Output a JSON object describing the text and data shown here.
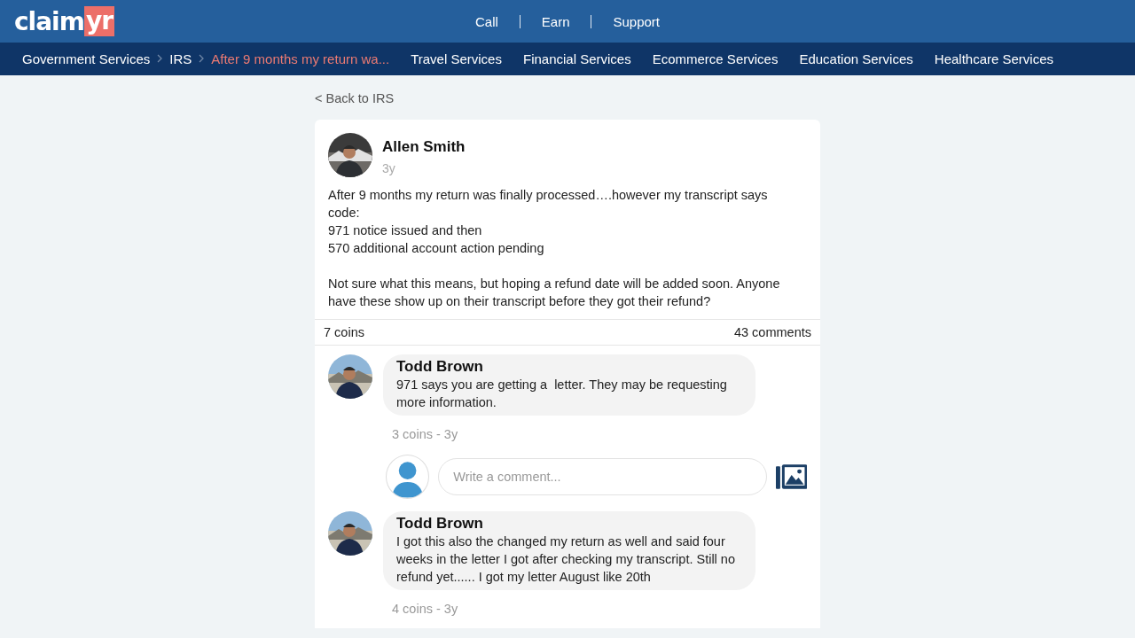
{
  "header": {
    "logo": {
      "text": "claim",
      "highlight": "yr"
    },
    "links": [
      "Call",
      "Earn",
      "Support"
    ]
  },
  "nav": {
    "breadcrumbs": [
      {
        "label": "Government Services",
        "current": false
      },
      {
        "label": "IRS",
        "current": false
      },
      {
        "label": "After 9 months my return wa...",
        "current": true
      }
    ],
    "categories": [
      "Travel Services",
      "Financial Services",
      "Ecommerce Services",
      "Education Services",
      "Healthcare Services"
    ]
  },
  "back_link": "< Back to IRS",
  "post": {
    "author": "Allen Smith",
    "time": "3y",
    "body": "After 9 months my return was finally processed….however my transcript says code:\n971 notice issued and then\n570 additional account action pending\n\nNot sure what this means, but hoping a refund date will be added soon. Anyone have these show up on their transcript before they got their refund?",
    "coins": "7 coins",
    "comments_count": "43 comments"
  },
  "comments": [
    {
      "author": "Todd Brown",
      "text": "971 says you are getting a  letter. They may be requesting more information.",
      "meta": "3 coins - 3y",
      "reply_box": {
        "placeholder": "Write a comment..."
      }
    },
    {
      "author": "Todd Brown",
      "text": "I got this also the changed my return as well and said four weeks in the letter I got after checking my transcript. Still no refund yet...... I got my letter August like 20th",
      "meta": "4 coins - 3y"
    }
  ]
}
